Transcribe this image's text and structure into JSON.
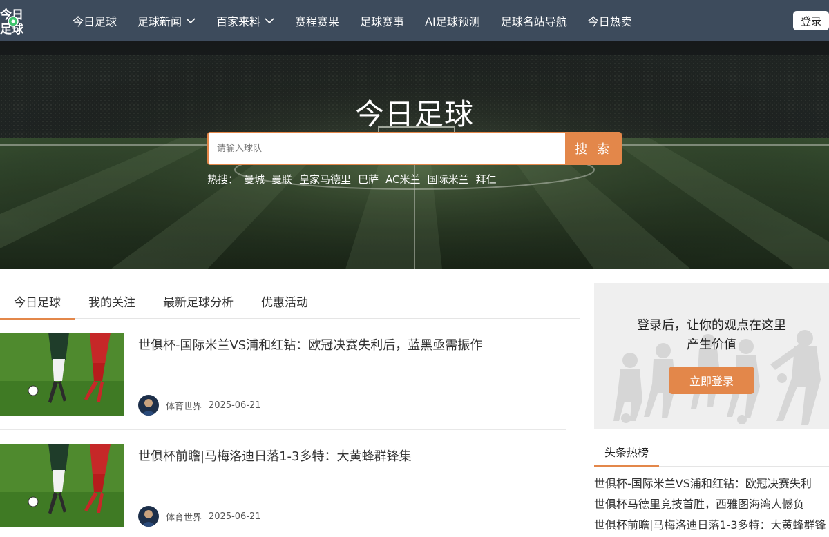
{
  "brand": {
    "logo_text_top": "今日",
    "logo_text_bottom": "足球"
  },
  "nav": {
    "items": [
      {
        "label": "今日足球",
        "dropdown": false
      },
      {
        "label": "足球新闻",
        "dropdown": true
      },
      {
        "label": "百家来料",
        "dropdown": true
      },
      {
        "label": "赛程赛果",
        "dropdown": false
      },
      {
        "label": "足球赛事",
        "dropdown": false
      },
      {
        "label": "AI足球预测",
        "dropdown": false
      },
      {
        "label": "足球名站导航",
        "dropdown": false
      },
      {
        "label": "今日热卖",
        "dropdown": false
      }
    ],
    "login_label": "登录"
  },
  "hero": {
    "title": "今日足球",
    "search": {
      "placeholder": "请输入球队",
      "value": "",
      "button_label": "搜 索"
    },
    "hot_label": "热搜：",
    "hot_tags": [
      "曼城",
      "曼联",
      "皇家马德里",
      "巴萨",
      "AC米兰",
      "国际米兰",
      "拜仁"
    ]
  },
  "tabs": [
    {
      "label": "今日足球",
      "active": true
    },
    {
      "label": "我的关注",
      "active": false
    },
    {
      "label": "最新足球分析",
      "active": false
    },
    {
      "label": "优惠活动",
      "active": false
    }
  ],
  "articles": [
    {
      "title": "世俱杯-国际米兰VS浦和红钻：欧冠决赛失利后，蓝黑亟需振作",
      "author": "体育世界",
      "date": "2025-06-21"
    },
    {
      "title": "世俱杯前瞻|马梅洛迪日落1-3多特：大黄蜂群锋集",
      "author": "体育世界",
      "date": "2025-06-21"
    }
  ],
  "sidebar": {
    "promo_line1": "登录后，让你的观点在这里",
    "promo_line2": "产生价值",
    "promo_button": "立即登录",
    "hot_title": "头条热榜",
    "hot_items": [
      "世俱杯-国际米兰VS浦和红钻：欧冠决赛失利",
      "世俱杯马德里竞技首胜，西雅图海湾人憾负",
      "世俱杯前瞻|马梅洛迪日落1-3多特：大黄蜂群锋"
    ]
  },
  "colors": {
    "nav_bg": "#3d4b5c",
    "accent": "#e3874a"
  }
}
